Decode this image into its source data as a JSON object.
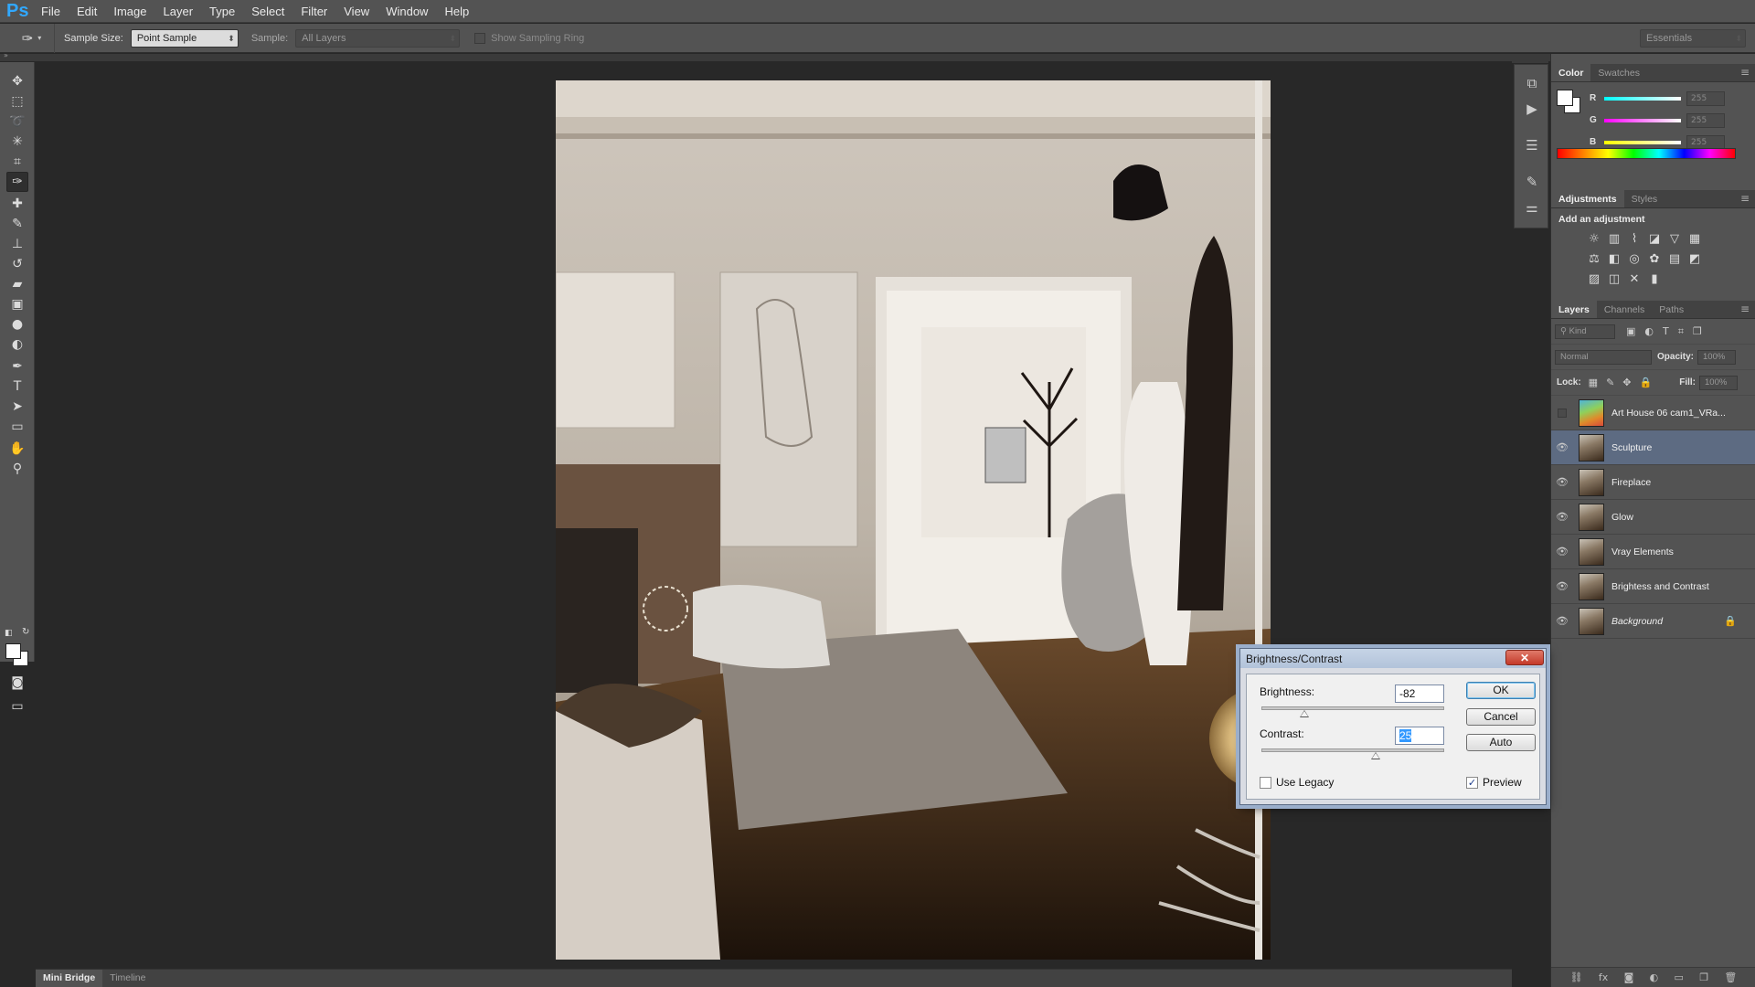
{
  "app": {
    "logo": "Ps"
  },
  "menu": [
    "File",
    "Edit",
    "Image",
    "Layer",
    "Type",
    "Select",
    "Filter",
    "View",
    "Window",
    "Help"
  ],
  "options_bar": {
    "tool_icon": "eyedropper-icon",
    "sample_size_label": "Sample Size:",
    "sample_size_value": "Point Sample",
    "sample_label": "Sample:",
    "sample_value": "All Layers",
    "show_sampling_ring_label": "Show Sampling Ring",
    "show_sampling_ring_checked": false,
    "workspace": "Essentials"
  },
  "toolbox": {
    "tools": [
      {
        "name": "move-tool",
        "glyph": "✥"
      },
      {
        "name": "marquee-tool",
        "glyph": "⬚"
      },
      {
        "name": "lasso-tool",
        "glyph": "➰"
      },
      {
        "name": "magic-wand-tool",
        "glyph": "✳"
      },
      {
        "name": "crop-tool",
        "glyph": "⌗"
      },
      {
        "name": "eyedropper-tool",
        "glyph": "✑"
      },
      {
        "name": "spot-healing-tool",
        "glyph": "✚"
      },
      {
        "name": "brush-tool",
        "glyph": "✎"
      },
      {
        "name": "clone-stamp-tool",
        "glyph": "⊥"
      },
      {
        "name": "history-brush-tool",
        "glyph": "↺"
      },
      {
        "name": "eraser-tool",
        "glyph": "▰"
      },
      {
        "name": "gradient-tool",
        "glyph": "▣"
      },
      {
        "name": "blur-tool",
        "glyph": "●"
      },
      {
        "name": "dodge-tool",
        "glyph": "◐"
      },
      {
        "name": "pen-tool",
        "glyph": "✒"
      },
      {
        "name": "type-tool",
        "glyph": "T"
      },
      {
        "name": "path-selection-tool",
        "glyph": "➤"
      },
      {
        "name": "rectangle-tool",
        "glyph": "▭"
      },
      {
        "name": "hand-tool",
        "glyph": "✋"
      },
      {
        "name": "zoom-tool",
        "glyph": "⚲"
      }
    ],
    "active_tool": "eyedropper-tool",
    "quick_mask_glyph": "◙",
    "screen_mode_glyph": "▭",
    "foreground_color": "#ffffff",
    "background_color": "#ffffff"
  },
  "color_panel": {
    "tabs": [
      "Color",
      "Swatches"
    ],
    "active_tab": "Color",
    "channels": [
      {
        "label": "R",
        "value": "255",
        "gradient": "linear-gradient(90deg,#00ffff,#ffffff)"
      },
      {
        "label": "G",
        "value": "255",
        "gradient": "linear-gradient(90deg,#ff00ff,#ffffff)"
      },
      {
        "label": "B",
        "value": "255",
        "gradient": "linear-gradient(90deg,#ffff00,#ffffff)"
      }
    ]
  },
  "adjustments_panel": {
    "tabs": [
      "Adjustments",
      "Styles"
    ],
    "active_tab": "Adjustments",
    "title": "Add an adjustment",
    "icons": [
      "brightness-contrast-icon",
      "levels-icon",
      "curves-icon",
      "exposure-icon",
      "vibrance-icon",
      "hue-saturation-icon",
      "color-balance-icon",
      "black-white-icon",
      "photo-filter-icon",
      "channel-mixer-icon",
      "color-lookup-icon",
      "invert-icon",
      "posterize-icon",
      "threshold-icon",
      "selective-color-icon",
      "gradient-map-icon"
    ],
    "glyphs": [
      "☼",
      "▥",
      "⌇",
      "◪",
      "▽",
      "▦",
      "⚖",
      "◧",
      "◎",
      "✿",
      "▤",
      "◩",
      "▨",
      "◫",
      "✕",
      "▮"
    ]
  },
  "layers_panel": {
    "tabs": [
      "Layers",
      "Channels",
      "Paths"
    ],
    "active_tab": "Layers",
    "kind_label": "Kind",
    "blend_mode": "Normal",
    "opacity_label": "Opacity:",
    "opacity_value": "100%",
    "lock_label": "Lock:",
    "fill_label": "Fill:",
    "fill_value": "100%",
    "layers": [
      {
        "name": "Art House 06 cam1_VRa...",
        "visible": false,
        "selected": false,
        "thumb": "col",
        "italic": false,
        "locked": false
      },
      {
        "name": "Sculpture",
        "visible": true,
        "selected": true,
        "thumb": "",
        "italic": false,
        "locked": false
      },
      {
        "name": "Fireplace",
        "visible": true,
        "selected": false,
        "thumb": "",
        "italic": false,
        "locked": false
      },
      {
        "name": "Glow",
        "visible": true,
        "selected": false,
        "thumb": "",
        "italic": false,
        "locked": false
      },
      {
        "name": "Vray Elements",
        "visible": true,
        "selected": false,
        "thumb": "",
        "italic": false,
        "locked": false
      },
      {
        "name": "Brightess and Contrast",
        "visible": true,
        "selected": false,
        "thumb": "",
        "italic": false,
        "locked": false
      },
      {
        "name": "Background",
        "visible": true,
        "selected": false,
        "thumb": "",
        "italic": true,
        "locked": true
      }
    ],
    "footer_icons": [
      "link-icon",
      "fx-icon",
      "mask-icon",
      "adjustment-layer-icon",
      "group-icon",
      "new-layer-icon",
      "trash-icon"
    ],
    "footer_glyphs": [
      "⛓",
      "fx",
      "◙",
      "◐",
      "▭",
      "❐",
      "🗑"
    ]
  },
  "bottom_tabs": [
    "Mini Bridge",
    "Timeline"
  ],
  "dialog": {
    "title": "Brightness/Contrast",
    "brightness_label": "Brightness:",
    "brightness_value": "-82",
    "brightness_fraction": 0.23,
    "contrast_label": "Contrast:",
    "contrast_value": "25",
    "contrast_fraction": 0.62,
    "use_legacy_label": "Use Legacy",
    "use_legacy_checked": false,
    "preview_label": "Preview",
    "preview_checked": true,
    "ok_label": "OK",
    "cancel_label": "Cancel",
    "auto_label": "Auto",
    "close_glyph": "✕"
  },
  "colors": {
    "ui_panel": "#535353",
    "ui_dark": "#282828",
    "selection_blue": "#5d6b82",
    "ps_blue": "#31a8ff"
  }
}
